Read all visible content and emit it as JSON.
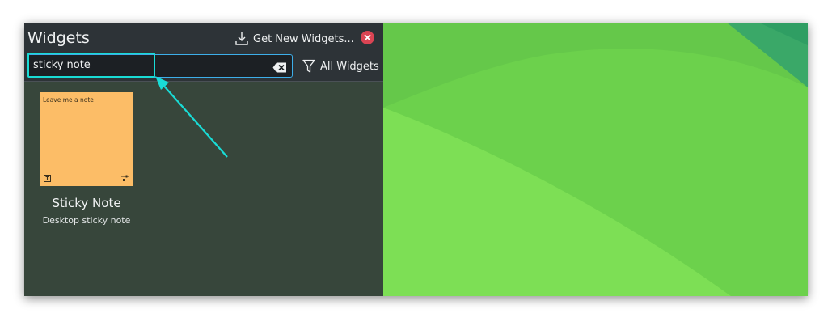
{
  "panel": {
    "title": "Widgets",
    "get_new_label": "Get New Widgets...",
    "search": {
      "value": "sticky note"
    },
    "filter_label": "All Widgets"
  },
  "widgets": [
    {
      "name": "Sticky Note",
      "description": "Desktop sticky note",
      "preview_text": "Leave me a note",
      "preview_color": "#fcbd67"
    }
  ],
  "colors": {
    "panel_bg": "#37463b",
    "header_bg": "#2d3337",
    "accent": "#3daee9",
    "highlight": "#19dcd6",
    "close": "#da4453",
    "desktop_green": "#6cd14c"
  },
  "icons": {
    "download": "download-icon",
    "close": "close-icon",
    "clear": "clear-text-icon",
    "filter": "filter-icon"
  }
}
